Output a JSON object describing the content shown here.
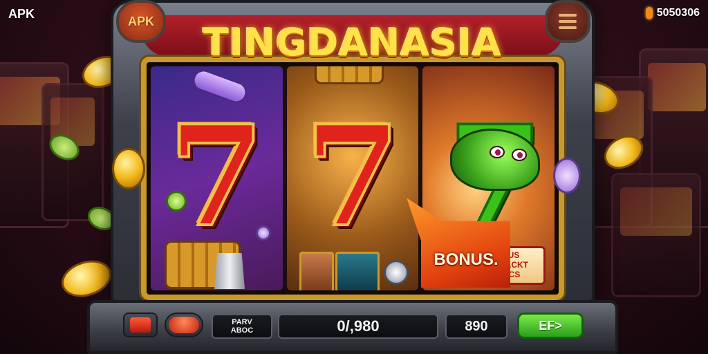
{
  "corner": {
    "left_label": "APK",
    "right_counter": "5050306"
  },
  "machine": {
    "badge_label": "APK",
    "title": "TINGDANASIA"
  },
  "reels": {
    "mini_card_caption": "",
    "sign_lines": [
      "GONUS",
      "INTERACKT",
      "AADICS"
    ]
  },
  "bonus": {
    "label": "BONUS."
  },
  "panel": {
    "label_line1": "PARV",
    "label_line2": "ABOC",
    "main_value": "0/,980",
    "side_value": "890",
    "spin_label": "EF>"
  },
  "colors": {
    "accent": "#ffe14a",
    "reel_frame": "#c9992c",
    "spin_button": "#2aa01a",
    "bonus": "#e2420f"
  },
  "icons": [
    "menu-icon",
    "coin-icon",
    "seven-symbol",
    "barrel-icon",
    "cup-icon",
    "dragon-creature",
    "chest-icon",
    "bonus-arrow"
  ]
}
